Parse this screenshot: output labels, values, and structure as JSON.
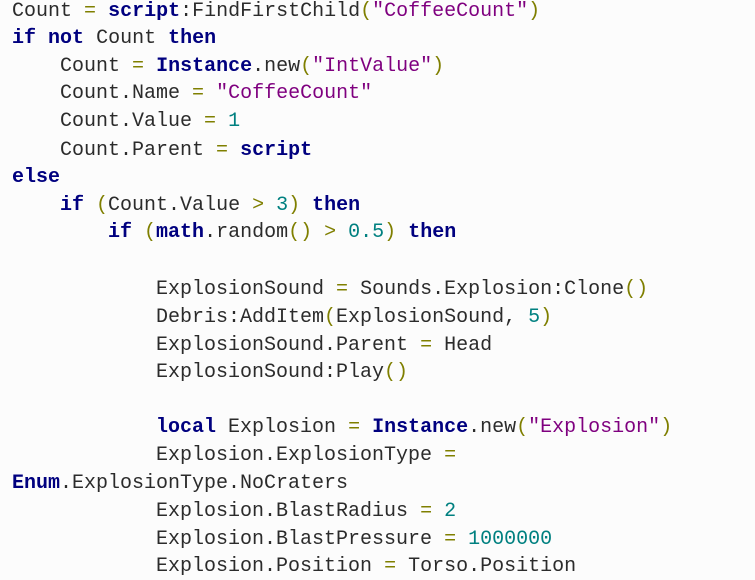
{
  "editor": {
    "language": "lua",
    "colors": {
      "background": "#fcfcfc",
      "keyword": "#00007f",
      "string": "#7f007f",
      "number": "#008080",
      "operator": "#7f7f00",
      "identifier": "#2b2b2b"
    },
    "lines": [
      {
        "indent": 0,
        "tokens": [
          [
            "id",
            "Count"
          ],
          [
            "sp",
            " "
          ],
          [
            "op",
            "="
          ],
          [
            "sp",
            " "
          ],
          [
            "kw",
            "script"
          ],
          [
            "id",
            ":FindFirstChild"
          ],
          [
            "paren",
            "("
          ],
          [
            "str",
            "\"CoffeeCount\""
          ],
          [
            "paren",
            ")"
          ]
        ]
      },
      {
        "indent": 0,
        "tokens": [
          [
            "kw",
            "if"
          ],
          [
            "sp",
            " "
          ],
          [
            "kw",
            "not"
          ],
          [
            "sp",
            " "
          ],
          [
            "id",
            "Count"
          ],
          [
            "sp",
            " "
          ],
          [
            "kw",
            "then"
          ]
        ]
      },
      {
        "indent": 1,
        "tokens": [
          [
            "id",
            "Count"
          ],
          [
            "sp",
            " "
          ],
          [
            "op",
            "="
          ],
          [
            "sp",
            " "
          ],
          [
            "kw",
            "Instance"
          ],
          [
            "id",
            ".new"
          ],
          [
            "paren",
            "("
          ],
          [
            "str",
            "\"IntValue\""
          ],
          [
            "paren",
            ")"
          ]
        ]
      },
      {
        "indent": 1,
        "tokens": [
          [
            "id",
            "Count.Name"
          ],
          [
            "sp",
            " "
          ],
          [
            "op",
            "="
          ],
          [
            "sp",
            " "
          ],
          [
            "str",
            "\"CoffeeCount\""
          ]
        ]
      },
      {
        "indent": 1,
        "tokens": [
          [
            "id",
            "Count.Value"
          ],
          [
            "sp",
            " "
          ],
          [
            "op",
            "="
          ],
          [
            "sp",
            " "
          ],
          [
            "num",
            "1"
          ]
        ]
      },
      {
        "indent": 1,
        "tokens": [
          [
            "id",
            "Count.Parent"
          ],
          [
            "sp",
            " "
          ],
          [
            "op",
            "="
          ],
          [
            "sp",
            " "
          ],
          [
            "kw",
            "script"
          ]
        ]
      },
      {
        "indent": 0,
        "tokens": [
          [
            "kw",
            "else"
          ]
        ]
      },
      {
        "indent": 1,
        "tokens": [
          [
            "kw",
            "if"
          ],
          [
            "sp",
            " "
          ],
          [
            "paren",
            "("
          ],
          [
            "id",
            "Count.Value"
          ],
          [
            "sp",
            " "
          ],
          [
            "op",
            ">"
          ],
          [
            "sp",
            " "
          ],
          [
            "num",
            "3"
          ],
          [
            "paren",
            ")"
          ],
          [
            "sp",
            " "
          ],
          [
            "kw",
            "then"
          ]
        ]
      },
      {
        "indent": 2,
        "tokens": [
          [
            "kw",
            "if"
          ],
          [
            "sp",
            " "
          ],
          [
            "paren",
            "("
          ],
          [
            "kw",
            "math"
          ],
          [
            "id",
            ".random"
          ],
          [
            "paren",
            "()"
          ],
          [
            "sp",
            " "
          ],
          [
            "op",
            ">"
          ],
          [
            "sp",
            " "
          ],
          [
            "num",
            "0.5"
          ],
          [
            "paren",
            ")"
          ],
          [
            "sp",
            " "
          ],
          [
            "kw",
            "then"
          ]
        ]
      },
      {
        "indent": 0,
        "tokens": []
      },
      {
        "indent": 3,
        "tokens": [
          [
            "id",
            "ExplosionSound"
          ],
          [
            "sp",
            " "
          ],
          [
            "op",
            "="
          ],
          [
            "sp",
            " "
          ],
          [
            "id",
            "Sounds.Explosion:Clone"
          ],
          [
            "paren",
            "()"
          ]
        ]
      },
      {
        "indent": 3,
        "tokens": [
          [
            "id",
            "Debris:AddItem"
          ],
          [
            "paren",
            "("
          ],
          [
            "id",
            "ExplosionSound,"
          ],
          [
            "sp",
            " "
          ],
          [
            "num",
            "5"
          ],
          [
            "paren",
            ")"
          ]
        ]
      },
      {
        "indent": 3,
        "tokens": [
          [
            "id",
            "ExplosionSound.Parent"
          ],
          [
            "sp",
            " "
          ],
          [
            "op",
            "="
          ],
          [
            "sp",
            " "
          ],
          [
            "id",
            "Head"
          ]
        ]
      },
      {
        "indent": 3,
        "tokens": [
          [
            "id",
            "ExplosionSound:Play"
          ],
          [
            "paren",
            "()"
          ]
        ]
      },
      {
        "indent": 0,
        "tokens": []
      },
      {
        "indent": 3,
        "tokens": [
          [
            "kw",
            "local"
          ],
          [
            "sp",
            " "
          ],
          [
            "id",
            "Explosion"
          ],
          [
            "sp",
            " "
          ],
          [
            "op",
            "="
          ],
          [
            "sp",
            " "
          ],
          [
            "kw",
            "Instance"
          ],
          [
            "id",
            ".new"
          ],
          [
            "paren",
            "("
          ],
          [
            "str",
            "\"Explosion\""
          ],
          [
            "paren",
            ")"
          ]
        ]
      },
      {
        "indent": 3,
        "tokens": [
          [
            "id",
            "Explosion.ExplosionType"
          ],
          [
            "sp",
            " "
          ],
          [
            "op",
            "="
          ]
        ]
      },
      {
        "indent": 0,
        "tokens": [
          [
            "kw",
            "Enum"
          ],
          [
            "id",
            ".ExplosionType.NoCraters"
          ]
        ]
      },
      {
        "indent": 3,
        "tokens": [
          [
            "id",
            "Explosion.BlastRadius"
          ],
          [
            "sp",
            " "
          ],
          [
            "op",
            "="
          ],
          [
            "sp",
            " "
          ],
          [
            "num",
            "2"
          ]
        ]
      },
      {
        "indent": 3,
        "tokens": [
          [
            "id",
            "Explosion.BlastPressure"
          ],
          [
            "sp",
            " "
          ],
          [
            "op",
            "="
          ],
          [
            "sp",
            " "
          ],
          [
            "num",
            "1000000"
          ]
        ]
      },
      {
        "indent": 3,
        "tokens": [
          [
            "id",
            "Explosion.Position"
          ],
          [
            "sp",
            " "
          ],
          [
            "op",
            "="
          ],
          [
            "sp",
            " "
          ],
          [
            "id",
            "Torso.Position"
          ]
        ]
      }
    ]
  }
}
